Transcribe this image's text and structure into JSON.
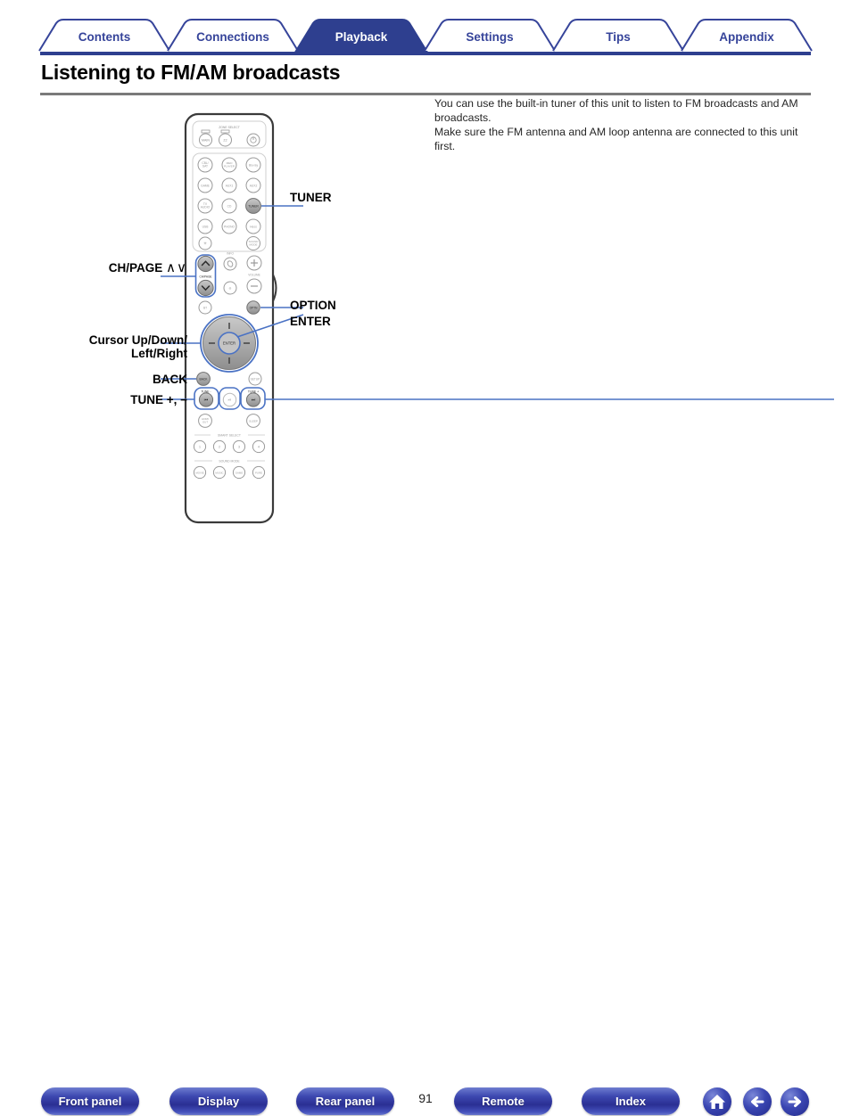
{
  "tabs": [
    {
      "label": "Contents",
      "active": false
    },
    {
      "label": "Connections",
      "active": false
    },
    {
      "label": "Playback",
      "active": true
    },
    {
      "label": "Settings",
      "active": false
    },
    {
      "label": "Tips",
      "active": false
    },
    {
      "label": "Appendix",
      "active": false
    }
  ],
  "page": {
    "title": "Listening to FM/AM broadcasts",
    "number": "91"
  },
  "intro": {
    "paragraph1": "You can use the built-in tuner of this unit to listen to FM broadcasts and AM broadcasts.",
    "paragraph2": "Make sure the FM antenna and AM loop antenna are connected to this unit first."
  },
  "callouts": {
    "tuner": "TUNER",
    "ch_page": "CH/PAGE",
    "ch_page_arrows": "∧∨",
    "option": "OPTION",
    "enter": "ENTER",
    "cursor_line1": "Cursor Up/Down/",
    "cursor_line2": "Left/Right",
    "back": "BACK",
    "tune": "TUNE +, −"
  },
  "remote": {
    "zone_select_label": "ZONE SELECT",
    "zone_buttons": [
      "MAIN",
      "Z2"
    ],
    "power_label": "⏻",
    "source_buttons": [
      "CBL/SAT",
      "MED PLAYER",
      "Blu-ray",
      "GAME",
      "AUX1",
      "AUX2",
      "TV AUDIO",
      "CD",
      "TUNER",
      "USB",
      "PHONO",
      "Heos",
      "BT",
      "SOUND MODE"
    ],
    "ch_page_label": "CH/PAGE",
    "volume_label": "VOLUME",
    "info_label": "INFO",
    "mute_label": "MUTE",
    "option_label": "OPTN",
    "enter_label": "ENTER",
    "back_label": "BACK",
    "setup_label": "SETUP",
    "tune_minus_label": "TUNE -",
    "tune_plus_label": "TUNE +",
    "hdmi_out_label": "HDMI OUT",
    "sleep_label": "SLEEP",
    "smart_select_label": "SMART SELECT",
    "smart_select_buttons": [
      "1",
      "2",
      "3",
      "4"
    ],
    "sound_mode_label": "SOUND MODE",
    "sound_mode_buttons": [
      "MOVIE",
      "MUSIC",
      "GAME",
      "PURE"
    ]
  },
  "footer": {
    "buttons": [
      {
        "label": "Front panel",
        "name": "front-panel"
      },
      {
        "label": "Display",
        "name": "display"
      },
      {
        "label": "Rear panel",
        "name": "rear-panel"
      },
      {
        "label": "Remote",
        "name": "remote"
      },
      {
        "label": "Index",
        "name": "index"
      }
    ],
    "icons": [
      {
        "name": "home-icon"
      },
      {
        "name": "arrow-left-icon"
      },
      {
        "name": "arrow-right-icon"
      }
    ]
  },
  "colors": {
    "brand_indigo": "#2e3f8f",
    "tab_text": "#36449a",
    "rule_gray": "#7a7a7a",
    "highlight_blue": "#4a72c4",
    "button_gray": "#9a9a9a"
  }
}
